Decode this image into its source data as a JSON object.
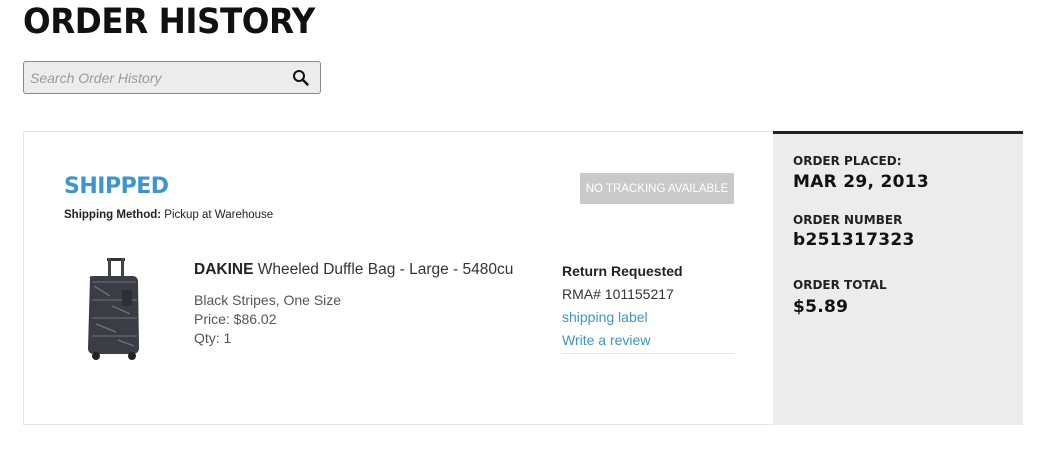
{
  "page": {
    "title": "ORDER HISTORY"
  },
  "search": {
    "placeholder": "Search Order History",
    "value": ""
  },
  "order": {
    "status": "SHIPPED",
    "shipping_method_label": "Shipping Method:",
    "shipping_method_value": "Pickup at Warehouse",
    "tracking_button": "NO TRACKING AVAILABLE",
    "item": {
      "brand": "DAKINE",
      "name": "Wheeled Duffle Bag - Large - 5480cu",
      "variant": "Black Stripes, One Size",
      "price": "Price: $86.02",
      "qty": "Qty: 1",
      "image_icon": "duffle-bag-image"
    },
    "return": {
      "title": "Return Requested",
      "rma": "RMA# 101155217",
      "shipping_label_link": "shipping label",
      "review_link": "Write a review"
    },
    "summary": {
      "placed_label": "ORDER PLACED:",
      "placed_value": "MAR 29, 2013",
      "number_label": "ORDER NUMBER",
      "number_value": "b251317323",
      "total_label": "ORDER TOTAL",
      "total_value": "$5.89"
    }
  },
  "colors": {
    "status_blue": "#3d94cf",
    "summary_bg": "#ececec",
    "tracking_btn_bg": "#c9c9c9"
  }
}
